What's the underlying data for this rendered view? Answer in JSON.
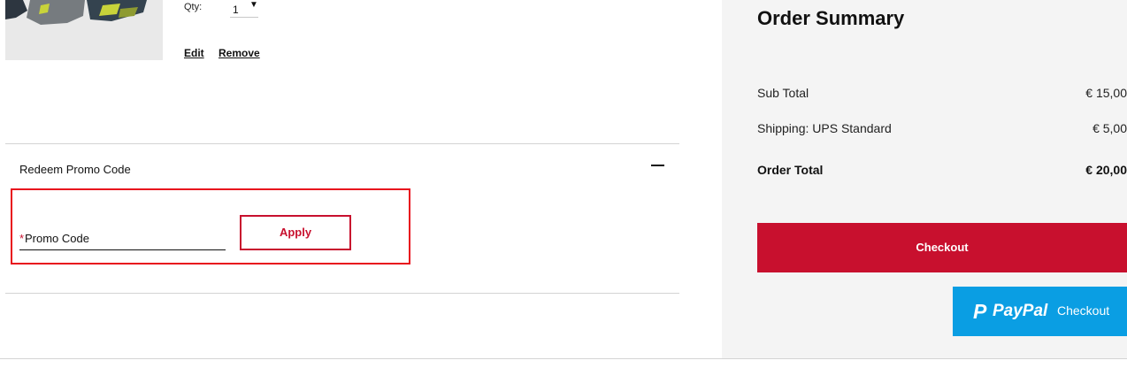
{
  "cart": {
    "product": {
      "image_icon": "socks-product-image",
      "qty_label": "Qty:",
      "qty_value": "1",
      "qty_arrow": "▼",
      "edit_label": "Edit",
      "remove_label": "Remove"
    }
  },
  "promo": {
    "title": "Redeem Promo Code",
    "collapse_icon": "minus-icon",
    "required_mark": "*",
    "field_label": "Promo Code",
    "apply_label": "Apply"
  },
  "summary": {
    "title": "Order Summary",
    "subtotal_label": "Sub Total",
    "subtotal_value": "€ 15,00",
    "shipping_label": "Shipping: UPS Standard",
    "shipping_value": "€ 5,00",
    "total_label": "Order Total",
    "total_value": "€ 20,00",
    "checkout_label": "Checkout",
    "paypal": {
      "icon": "paypal-icon",
      "logo_letter": "P",
      "brand": "PayPal",
      "label": "Checkout"
    }
  },
  "colors": {
    "accent": "#c8102e",
    "highlight_outline": "#e8101d",
    "paypal_blue": "#0a9ee3",
    "panel_background": "#f4f4f4"
  }
}
